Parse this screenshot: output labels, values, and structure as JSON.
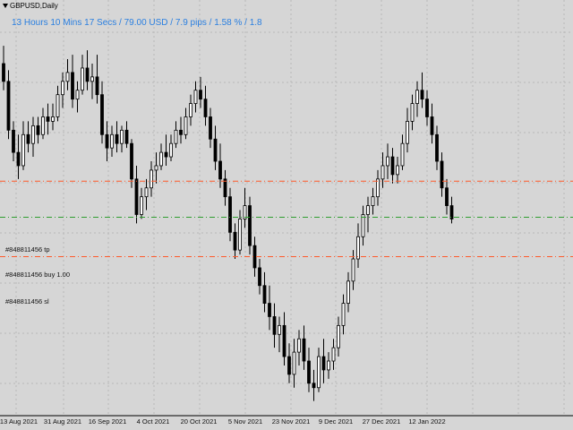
{
  "window": {
    "symbol_title": "GBPUSD,Daily"
  },
  "info_text": "13 Hours 10 Mins 17 Secs / 79.00 USD / 7.9 pips / 1.58 % / 1.8",
  "lines": {
    "tp": {
      "label": "#848811456 tp",
      "price": 1.3655,
      "color": "#ff5a2a"
    },
    "buy": {
      "label": "#848811456 buy 1.00",
      "price": 1.3574,
      "color": "#2f9e2f"
    },
    "sl": {
      "label": "#848811456 sl",
      "price": 1.3485,
      "color": "#ff5a2a"
    }
  },
  "colors": {
    "background": "#d6d6d6",
    "grid": "#b8b8b8",
    "bull_body": "#ffffff",
    "bear_body": "#000000",
    "wick": "#000000",
    "info": "#2a7fe0"
  },
  "chart_data": {
    "type": "candlestick",
    "symbol": "GBPUSD",
    "timeframe": "Daily",
    "x_tick_labels": [
      "13 Aug 2021",
      "31 Aug 2021",
      "16 Sep 2021",
      "4 Oct 2021",
      "20 Oct 2021",
      "5 Nov 2021",
      "23 Nov 2021",
      "9 Dec 2021",
      "27 Dec 2021",
      "12 Jan 2022"
    ],
    "ylim": [
      1.3135,
      1.4035
    ],
    "grid": true,
    "candles": [
      [
        1.392,
        1.396,
        1.386,
        1.388
      ],
      [
        1.388,
        1.3905,
        1.375,
        1.377
      ],
      [
        1.377,
        1.379,
        1.37,
        1.372
      ],
      [
        1.372,
        1.376,
        1.366,
        1.369
      ],
      [
        1.369,
        1.379,
        1.368,
        1.376
      ],
      [
        1.376,
        1.379,
        1.372,
        1.374
      ],
      [
        1.374,
        1.38,
        1.371,
        1.378
      ],
      [
        1.378,
        1.38,
        1.374,
        1.376
      ],
      [
        1.376,
        1.382,
        1.375,
        1.38
      ],
      [
        1.38,
        1.383,
        1.376,
        1.379
      ],
      [
        1.379,
        1.383,
        1.377,
        1.38
      ],
      [
        1.38,
        1.387,
        1.379,
        1.385
      ],
      [
        1.385,
        1.39,
        1.382,
        1.388
      ],
      [
        1.388,
        1.393,
        1.386,
        1.39
      ],
      [
        1.39,
        1.394,
        1.382,
        1.384
      ],
      [
        1.384,
        1.388,
        1.381,
        1.386
      ],
      [
        1.386,
        1.394,
        1.385,
        1.391
      ],
      [
        1.391,
        1.395,
        1.386,
        1.388
      ],
      [
        1.388,
        1.392,
        1.384,
        1.389
      ],
      [
        1.389,
        1.394,
        1.383,
        1.385
      ],
      [
        1.385,
        1.388,
        1.374,
        1.376
      ],
      [
        1.376,
        1.379,
        1.37,
        1.373
      ],
      [
        1.373,
        1.378,
        1.371,
        1.376
      ],
      [
        1.376,
        1.379,
        1.372,
        1.374
      ],
      [
        1.374,
        1.378,
        1.372,
        1.377
      ],
      [
        1.377,
        1.379,
        1.373,
        1.374
      ],
      [
        1.374,
        1.375,
        1.364,
        1.366
      ],
      [
        1.366,
        1.369,
        1.356,
        1.358
      ],
      [
        1.358,
        1.364,
        1.357,
        1.362
      ],
      [
        1.362,
        1.366,
        1.359,
        1.364
      ],
      [
        1.364,
        1.37,
        1.362,
        1.368
      ],
      [
        1.368,
        1.372,
        1.365,
        1.369
      ],
      [
        1.369,
        1.374,
        1.368,
        1.372
      ],
      [
        1.372,
        1.376,
        1.369,
        1.371
      ],
      [
        1.371,
        1.376,
        1.37,
        1.374
      ],
      [
        1.374,
        1.379,
        1.373,
        1.377
      ],
      [
        1.377,
        1.38,
        1.374,
        1.376
      ],
      [
        1.376,
        1.382,
        1.375,
        1.38
      ],
      [
        1.38,
        1.385,
        1.378,
        1.383
      ],
      [
        1.383,
        1.388,
        1.381,
        1.386
      ],
      [
        1.386,
        1.389,
        1.382,
        1.384
      ],
      [
        1.384,
        1.387,
        1.378,
        1.38
      ],
      [
        1.38,
        1.382,
        1.373,
        1.375
      ],
      [
        1.375,
        1.378,
        1.368,
        1.37
      ],
      [
        1.37,
        1.374,
        1.364,
        1.366
      ],
      [
        1.366,
        1.368,
        1.36,
        1.362
      ],
      [
        1.362,
        1.364,
        1.352,
        1.354
      ],
      [
        1.354,
        1.356,
        1.348,
        1.35
      ],
      [
        1.35,
        1.359,
        1.349,
        1.357
      ],
      [
        1.357,
        1.364,
        1.355,
        1.36
      ],
      [
        1.36,
        1.362,
        1.349,
        1.351
      ],
      [
        1.351,
        1.353,
        1.344,
        1.346
      ],
      [
        1.346,
        1.348,
        1.34,
        1.342
      ],
      [
        1.342,
        1.345,
        1.336,
        1.338
      ],
      [
        1.338,
        1.342,
        1.332,
        1.335
      ],
      [
        1.335,
        1.338,
        1.328,
        1.331
      ],
      [
        1.331,
        1.335,
        1.327,
        1.333
      ],
      [
        1.333,
        1.336,
        1.324,
        1.326
      ],
      [
        1.326,
        1.329,
        1.32,
        1.322
      ],
      [
        1.322,
        1.33,
        1.319,
        1.327
      ],
      [
        1.327,
        1.332,
        1.324,
        1.33
      ],
      [
        1.33,
        1.333,
        1.323,
        1.325
      ],
      [
        1.325,
        1.328,
        1.318,
        1.32
      ],
      [
        1.32,
        1.323,
        1.316,
        1.319
      ],
      [
        1.319,
        1.328,
        1.318,
        1.326
      ],
      [
        1.326,
        1.33,
        1.32,
        1.323
      ],
      [
        1.323,
        1.327,
        1.321,
        1.325
      ],
      [
        1.325,
        1.33,
        1.323,
        1.328
      ],
      [
        1.328,
        1.335,
        1.326,
        1.333
      ],
      [
        1.333,
        1.34,
        1.331,
        1.338
      ],
      [
        1.338,
        1.345,
        1.336,
        1.343
      ],
      [
        1.343,
        1.35,
        1.341,
        1.348
      ],
      [
        1.348,
        1.356,
        1.346,
        1.353
      ],
      [
        1.353,
        1.36,
        1.351,
        1.358
      ],
      [
        1.358,
        1.362,
        1.354,
        1.36
      ],
      [
        1.36,
        1.364,
        1.358,
        1.362
      ],
      [
        1.362,
        1.368,
        1.36,
        1.366
      ],
      [
        1.366,
        1.372,
        1.364,
        1.369
      ],
      [
        1.369,
        1.374,
        1.366,
        1.371
      ],
      [
        1.371,
        1.373,
        1.365,
        1.367
      ],
      [
        1.367,
        1.371,
        1.365,
        1.369
      ],
      [
        1.369,
        1.376,
        1.368,
        1.374
      ],
      [
        1.374,
        1.382,
        1.372,
        1.379
      ],
      [
        1.379,
        1.385,
        1.377,
        1.383
      ],
      [
        1.383,
        1.388,
        1.38,
        1.386
      ],
      [
        1.386,
        1.39,
        1.382,
        1.384
      ],
      [
        1.384,
        1.386,
        1.378,
        1.38
      ],
      [
        1.38,
        1.383,
        1.374,
        1.376
      ],
      [
        1.376,
        1.378,
        1.368,
        1.37
      ],
      [
        1.37,
        1.372,
        1.362,
        1.364
      ],
      [
        1.364,
        1.366,
        1.358,
        1.36
      ],
      [
        1.36,
        1.362,
        1.356,
        1.357
      ]
    ]
  }
}
